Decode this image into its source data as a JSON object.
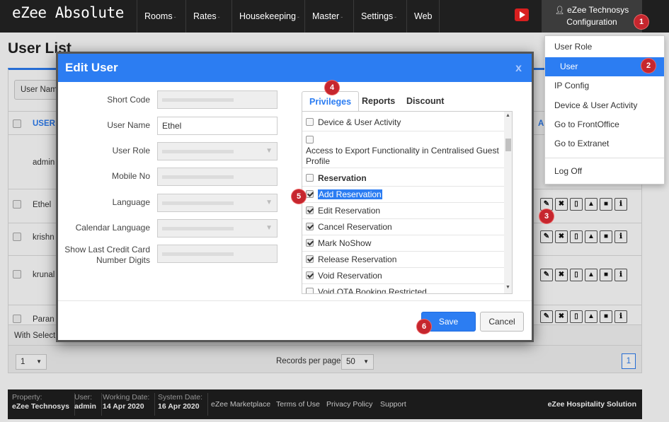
{
  "app": {
    "brand": "eZee Absolute"
  },
  "nav": {
    "items": [
      {
        "label": "Rooms",
        "caret": "-"
      },
      {
        "label": "Rates",
        "caret": "-"
      },
      {
        "label": "Housekeeping",
        "caret": "-"
      },
      {
        "label": "Master",
        "caret": "-"
      },
      {
        "label": "Settings",
        "caret": "-"
      },
      {
        "label": "Web",
        "caret": ""
      }
    ],
    "user": {
      "name": "eZee Technosys",
      "subtitle": "Configuration"
    }
  },
  "config_menu": {
    "items": [
      "User Role",
      "User",
      "IP Config",
      "Device & User Activity",
      "Go to FrontOffice",
      "Go to Extranet",
      "Log Off"
    ],
    "active": "User"
  },
  "page": {
    "title": "User List",
    "filter_label": "User Nam",
    "column_user": "USER",
    "column_action": "A",
    "rows": [
      "admin",
      "Ethel",
      "krishn",
      "krunal",
      "Paran"
    ],
    "with_selected": "With Select",
    "page_select": "1",
    "records_label": "Records per page",
    "records_value": "50",
    "page_number": "1"
  },
  "action_icons": [
    "edit-icon",
    "delete-icon",
    "device-icon",
    "lock-icon",
    "comment-icon",
    "info-icon"
  ],
  "modal": {
    "title": "Edit User",
    "close": "x",
    "fields": {
      "short_code": {
        "label": "Short Code",
        "value": ""
      },
      "user_name": {
        "label": "User Name",
        "value": "Ethel"
      },
      "user_role": {
        "label": "User Role",
        "value": ""
      },
      "mobile_no": {
        "label": "Mobile No",
        "value": ""
      },
      "language": {
        "label": "Language",
        "value": ""
      },
      "calendar_language": {
        "label": "Calendar Language",
        "value": ""
      },
      "last_cc_digits": {
        "label": "Show Last Credit Card Number Digits",
        "value": ""
      }
    },
    "tabs": [
      "Privileges",
      "Reports",
      "Discount"
    ],
    "active_tab": "Privileges",
    "privileges": [
      {
        "label": "Device & User Activity",
        "checked": false
      },
      {
        "label": "Access to Export Functionality in Centralised Guest Profile",
        "checked": false
      },
      {
        "label": "Reservation",
        "checked": false,
        "group": true
      },
      {
        "label": "Add Reservation",
        "checked": true,
        "selected": true
      },
      {
        "label": "Edit Reservation",
        "checked": true
      },
      {
        "label": "Cancel Reservation",
        "checked": true
      },
      {
        "label": "Mark NoShow",
        "checked": true
      },
      {
        "label": "Release Reservation",
        "checked": true
      },
      {
        "label": "Void Reservation",
        "checked": true
      },
      {
        "label": "Void OTA Booking Restricted",
        "checked": false
      }
    ],
    "save_label": "Save",
    "cancel_label": "Cancel"
  },
  "steps": [
    "1",
    "2",
    "3",
    "4",
    "5",
    "6"
  ],
  "footer": {
    "property_label": "Property:",
    "property_value": "eZee Technosys",
    "user_label": "User:",
    "user_value": "admin",
    "working_date_label": "Working Date:",
    "working_date_value": "14 Apr 2020",
    "system_date_label": "System Date:",
    "system_date_value": "16 Apr 2020",
    "links": [
      "eZee Marketplace",
      "Terms of Use",
      "Privacy Policy",
      "Support"
    ],
    "brand": "eZee Hospitality Solution"
  },
  "colors": {
    "accent": "#2c7df2",
    "topbar": "#1f1f1f",
    "badge": "#c6262e",
    "youtube": "#d81f1f"
  }
}
